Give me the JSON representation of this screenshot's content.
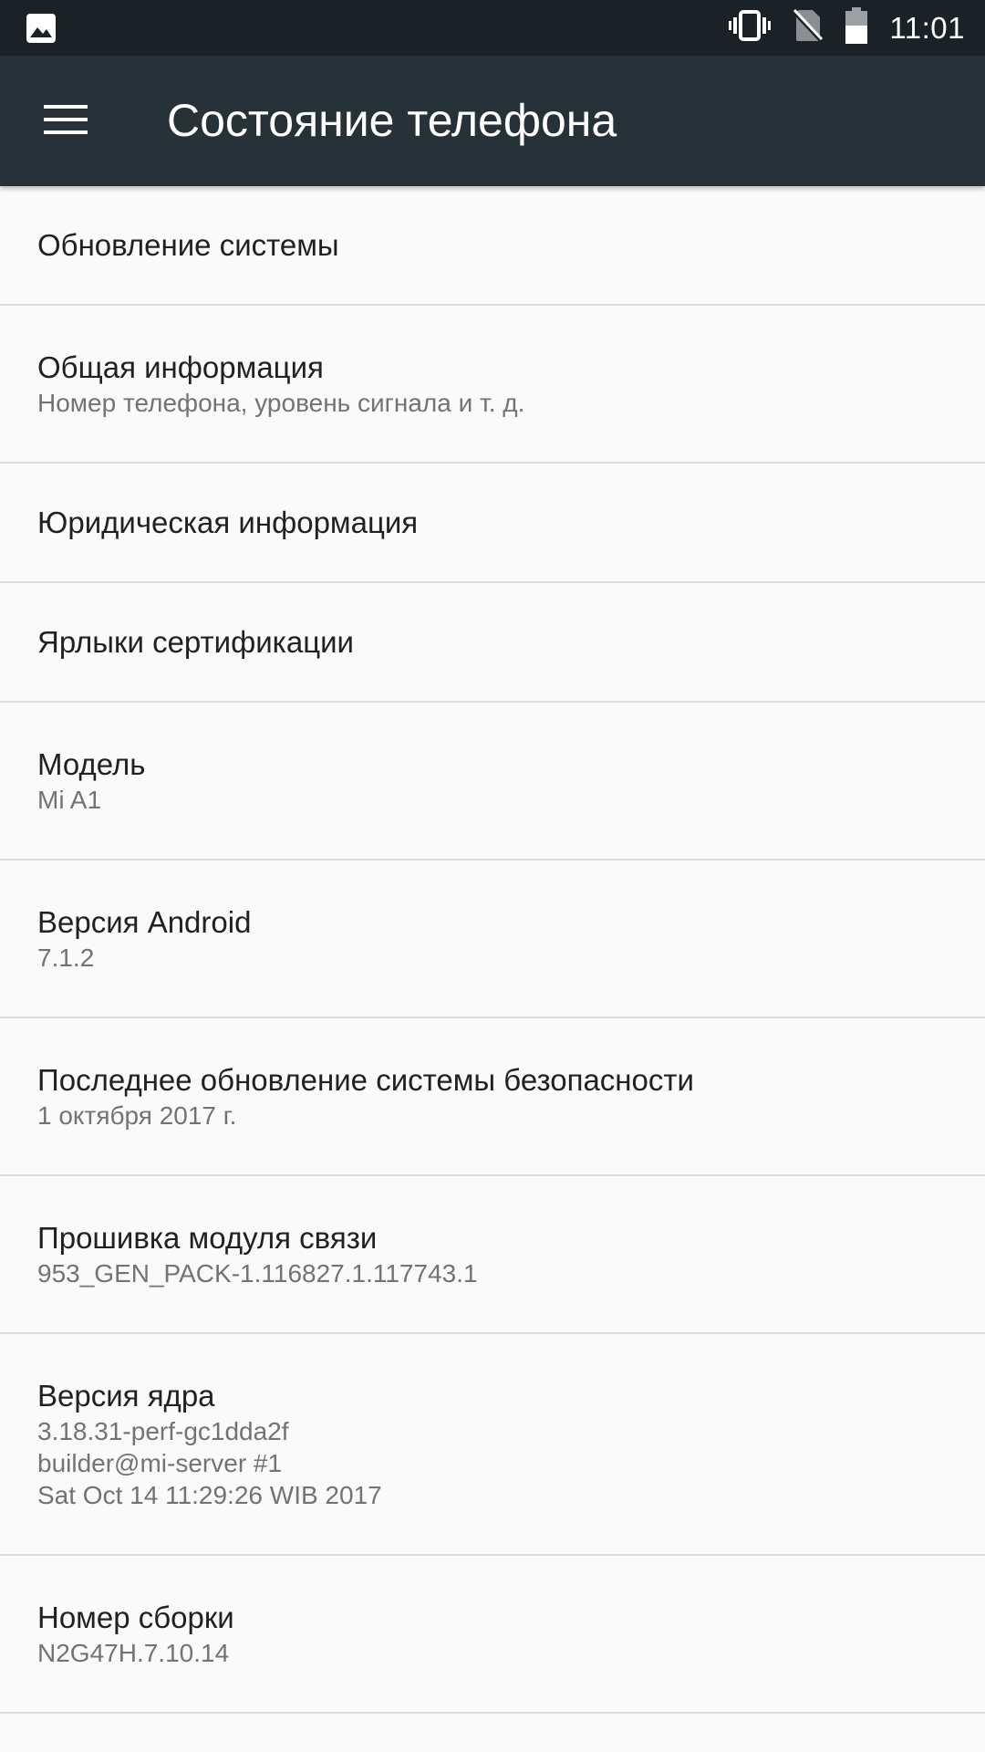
{
  "status_bar": {
    "time": "11:01",
    "icons": [
      "image-notification-icon",
      "vibrate-icon",
      "no-sim-icon",
      "battery-icon"
    ]
  },
  "toolbar": {
    "title": "Состояние телефона",
    "menu_icon": "hamburger-menu-icon"
  },
  "items": [
    {
      "title": "Обновление системы",
      "summary": ""
    },
    {
      "title": "Общая информация",
      "summary": "Номер телефона, уровень сигнала и т. д."
    },
    {
      "title": "Юридическая информация",
      "summary": ""
    },
    {
      "title": "Ярлыки сертификации",
      "summary": ""
    },
    {
      "title": "Модель",
      "summary": "Mi A1"
    },
    {
      "title": "Версия Android",
      "summary": "7.1.2"
    },
    {
      "title": "Последнее обновление системы безопасности",
      "summary": "1 октября 2017 г."
    },
    {
      "title": "Прошивка модуля связи",
      "summary": "953_GEN_PACK-1.116827.1.117743.1"
    },
    {
      "title": "Версия ядра",
      "summary": "3.18.31-perf-gc1dda2f\nbuilder@mi-server #1\nSat Oct 14 11:29:26 WIB 2017"
    },
    {
      "title": "Номер сборки",
      "summary": "N2G47H.7.10.14"
    }
  ],
  "colors": {
    "status_bar": "#1b2227",
    "toolbar": "#263238",
    "background": "#fafafa",
    "title_text": "#212121",
    "summary_text": "#737373",
    "divider": "#dcdcdc"
  }
}
